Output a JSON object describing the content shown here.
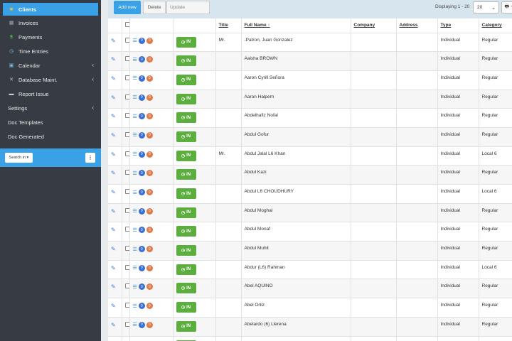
{
  "sidebar": {
    "items": [
      {
        "label": "Clients",
        "icon": "star-icon",
        "active": true,
        "chevron": false
      },
      {
        "label": "Invoices",
        "icon": "invoice-icon",
        "active": false,
        "chevron": false
      },
      {
        "label": "Payments",
        "icon": "money-icon",
        "active": false,
        "chevron": false
      },
      {
        "label": "Time Entries",
        "icon": "clock-icon",
        "active": false,
        "chevron": false
      },
      {
        "label": "Calendar",
        "icon": "calendar-icon",
        "active": false,
        "chevron": true
      },
      {
        "label": "Database Maint.",
        "icon": "tools-icon",
        "active": false,
        "chevron": true
      },
      {
        "label": "Report Issue",
        "icon": "comment-icon",
        "active": false,
        "chevron": false
      },
      {
        "label": "Settings",
        "icon": "",
        "active": false,
        "chevron": true
      },
      {
        "label": "Doc Templates",
        "icon": "",
        "active": false,
        "chevron": false
      },
      {
        "label": "Doc Generated",
        "icon": "",
        "active": false,
        "chevron": false
      }
    ],
    "search_label": "Search in ▾",
    "menu_label": "⋮"
  },
  "toolbar": {
    "add_label": "Add new",
    "delete_label": "Delete",
    "update_label": "Update",
    "displaying": "Displaying 1 - 20",
    "page_size": "20",
    "print_icon": "🖶 -"
  },
  "table": {
    "columns": [
      "",
      "",
      "",
      "",
      "Title",
      "Full Name ↑",
      "Company",
      "Address",
      "Type",
      "Category"
    ],
    "in_label": "IN",
    "badge_blue": "0",
    "badge_orange": "0",
    "rows": [
      {
        "title": "Mr.",
        "name": "-Patron, Juan Gonzalez",
        "company": "",
        "address": "",
        "type": "Individual",
        "category": "Regular"
      },
      {
        "title": "",
        "name": "Aaisha BROWN",
        "company": "",
        "address": "",
        "type": "Individual",
        "category": "Regular"
      },
      {
        "title": "",
        "name": "Aaron Cyrill Señora",
        "company": "",
        "address": "",
        "type": "Individual",
        "category": "Regular"
      },
      {
        "title": "",
        "name": "Aaron Halpern",
        "company": "",
        "address": "",
        "type": "Individual",
        "category": "Regular"
      },
      {
        "title": "",
        "name": "Abdelhafiz Nofal",
        "company": "",
        "address": "",
        "type": "Individual",
        "category": "Regular"
      },
      {
        "title": "",
        "name": "Abdul Gofur",
        "company": "",
        "address": "",
        "type": "Individual",
        "category": "Regular"
      },
      {
        "title": "Mr.",
        "name": "Abdul Jalal L6 Khan",
        "company": "",
        "address": "",
        "type": "Individual",
        "category": "Local 6"
      },
      {
        "title": "",
        "name": "Abdul Kazi",
        "company": "",
        "address": "",
        "type": "Individual",
        "category": "Regular"
      },
      {
        "title": "",
        "name": "Abdul L6 CHOUDHURY",
        "company": "",
        "address": "",
        "type": "Individual",
        "category": "Local 6"
      },
      {
        "title": "",
        "name": "Abdul Moghal",
        "company": "",
        "address": "",
        "type": "Individual",
        "category": "Regular"
      },
      {
        "title": "",
        "name": "Abdul Monaf",
        "company": "",
        "address": "",
        "type": "Individual",
        "category": "Regular"
      },
      {
        "title": "",
        "name": "Abdul Muhit",
        "company": "",
        "address": "",
        "type": "Individual",
        "category": "Regular"
      },
      {
        "title": "",
        "name": "Abdur (L6) Rahman",
        "company": "",
        "address": "",
        "type": "Individual",
        "category": "Local 6"
      },
      {
        "title": "",
        "name": "Abel AQUINO",
        "company": "",
        "address": "",
        "type": "Individual",
        "category": "Regular"
      },
      {
        "title": "",
        "name": "Abel Ortiz",
        "company": "",
        "address": "",
        "type": "Individual",
        "category": "Regular"
      },
      {
        "title": "",
        "name": "Abelardo (6) Llerena",
        "company": "",
        "address": "",
        "type": "Individual",
        "category": "Regular"
      },
      {
        "title": "",
        "name": "",
        "company": "",
        "address": "",
        "type": "",
        "category": ""
      }
    ]
  },
  "colors": {
    "sidebar_bg": "#373c44",
    "accent": "#3aa1e6",
    "in_button": "#5cae3e",
    "toolbar_bg": "#d7e6ee"
  }
}
